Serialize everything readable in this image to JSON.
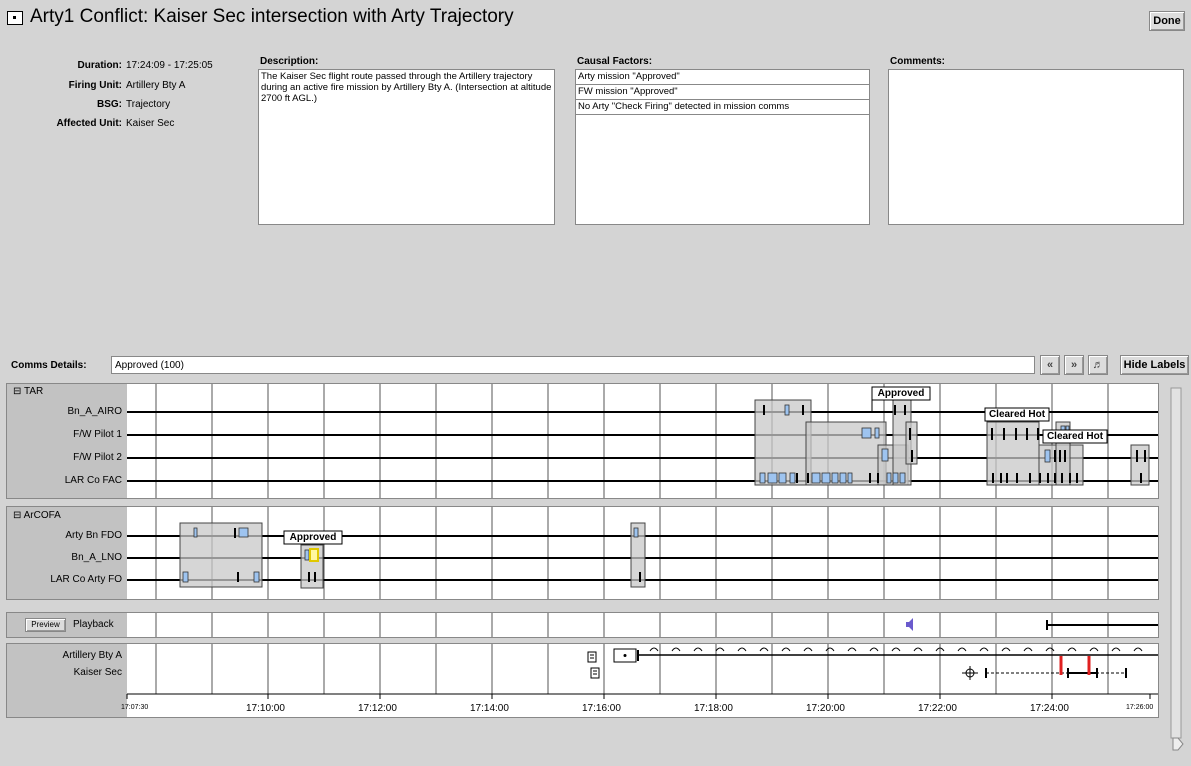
{
  "window": {
    "title": "Arty1 Conflict: Kaiser Sec intersection with Arty Trajectory",
    "done_label": "Done"
  },
  "info": [
    {
      "label": "Duration:",
      "value": "17:24:09 - 17:25:05"
    },
    {
      "label": "Firing Unit:",
      "value": "Artillery Bty A"
    },
    {
      "label": "BSG:",
      "value": "Trajectory"
    },
    {
      "label": "Affected Unit:",
      "value": "Kaiser Sec"
    }
  ],
  "description": {
    "header": "Description:",
    "text": "The Kaiser Sec flight route passed through the Artillery trajectory during an active fire mission by Artillery Bty A. (Intersection at altitude 2700 ft AGL.)"
  },
  "causal_factors": {
    "header": "Causal Factors:",
    "items": [
      "Arty mission \"Approved\"",
      "FW mission \"Approved\"",
      "No Arty \"Check Firing\" detected in mission comms"
    ]
  },
  "comments": {
    "header": "Comments:",
    "text": ""
  },
  "comms": {
    "label": "Comms Details:",
    "value": "Approved (100)",
    "hide_labels": "Hide Labels",
    "prev_icon": "double-chevron-left-icon",
    "next_icon": "double-chevron-right-icon",
    "audio_icon": "speaker-icon"
  },
  "groups": [
    {
      "name": "TAR",
      "rows": [
        "Bn_A_AIRO",
        "F/W Pilot 1",
        "F/W Pilot 2",
        "LAR Co FAC"
      ]
    },
    {
      "name": "ArCOFA",
      "rows": [
        "Arty Bn FDO",
        "Bn_A_LNO",
        "LAR Co Arty FO"
      ]
    }
  ],
  "callouts": [
    "Approved",
    "Cleared Hot",
    "Cleared Hot",
    "Approved"
  ],
  "playback": {
    "preview_label": "Preview",
    "label": "Playback"
  },
  "units": [
    "Artillery Bty A",
    "Kaiser Sec"
  ],
  "time_axis": [
    "17:07:30",
    "17:10:00",
    "17:12:00",
    "17:14:00",
    "17:16:00",
    "17:18:00",
    "17:20:00",
    "17:22:00",
    "17:24:00",
    "17:26:00"
  ],
  "colors": {
    "background": "#d4d4d4",
    "panel": "#ffffff",
    "label_column": "#c2c2c2",
    "comm_box": "#c8c8c8",
    "comm_mark": "#9ec4f0",
    "highlight": "#ffee00",
    "conflict": "#e02020"
  }
}
